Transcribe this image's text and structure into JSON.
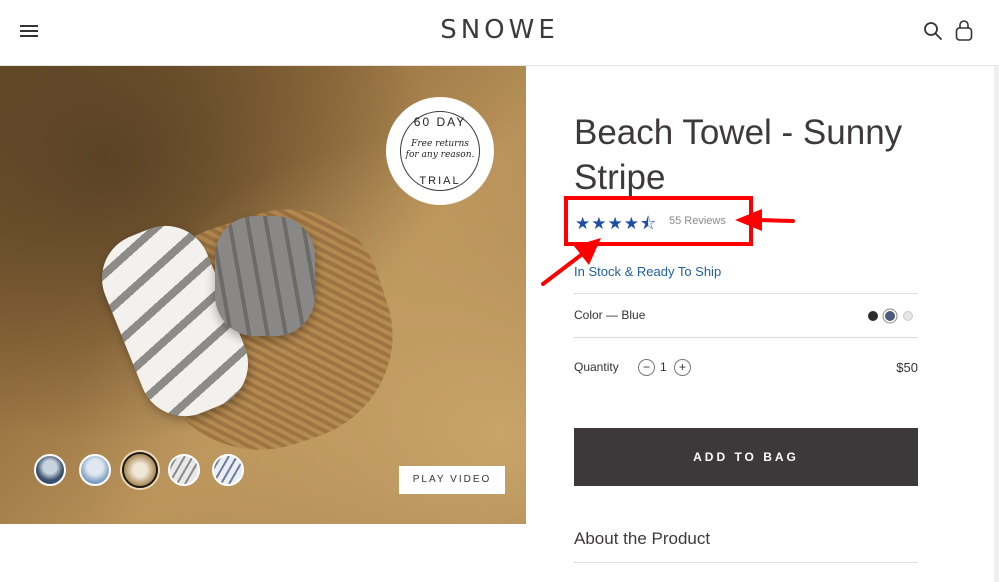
{
  "header": {
    "logo": "SNOWE",
    "icons": [
      "menu-icon",
      "search-icon",
      "bag-icon"
    ]
  },
  "hero": {
    "badge": {
      "top_text": "60 DAY",
      "middle_text_line1": "Free returns",
      "middle_text_line2": "for any reason.",
      "bottom_text": "TRIAL"
    },
    "thumbnails_count": 5,
    "active_thumbnail": 3,
    "play_video_label": "PLAY VIDEO"
  },
  "product": {
    "title": "Beach Towel - Sunny Stripe",
    "rating": 4.5,
    "stars_display": "★★★★⯪",
    "reviews_label": "55 Reviews",
    "stock_status": "In Stock & Ready To Ship",
    "color_label": "Color — Blue",
    "color_options": [
      "#2b2b2b",
      "#4a5a7a",
      "#e6e6e6"
    ],
    "selected_color_index": 1,
    "quantity_label": "Quantity",
    "quantity_minus": "−",
    "quantity_value": "1",
    "quantity_plus": "+",
    "price": "$50",
    "add_to_bag_label": "ADD TO BAG",
    "about_heading": "About the Product"
  },
  "annotation_color": "#ff0000"
}
